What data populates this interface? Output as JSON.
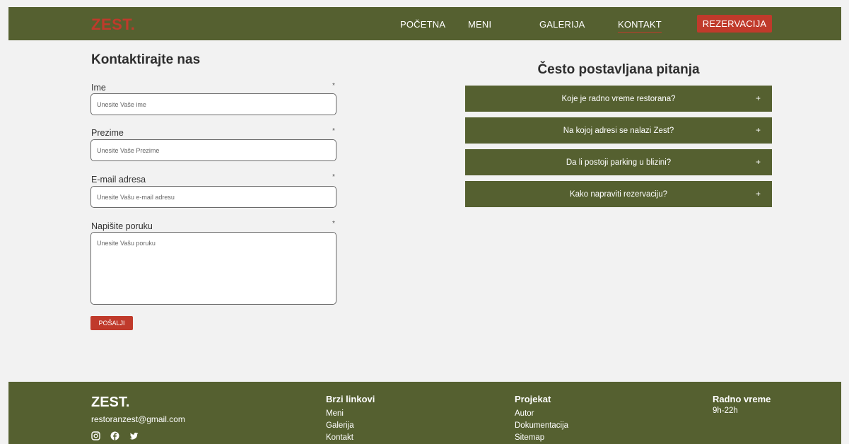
{
  "nav": {
    "logo": "ZEST.",
    "links": [
      "POČETNA",
      "MENI",
      "GALERIJA",
      "KONTAKT"
    ],
    "cta": "REZERVACIJA"
  },
  "form": {
    "title": "Kontaktirajte nas",
    "required_mark": "*",
    "fields": [
      {
        "label": "Ime",
        "placeholder": "Unesite Vaše ime"
      },
      {
        "label": "Prezime",
        "placeholder": "Unesite Vaše Prezime"
      },
      {
        "label": "E-mail adresa",
        "placeholder": "Unesite Vašu e-mail adresu"
      },
      {
        "label": "Napišite poruku",
        "placeholder": "Unesite Vašu poruku"
      }
    ],
    "submit": "POŠALJI"
  },
  "faq": {
    "title": "Često postavljana pitanja",
    "items": [
      "Koje je radno vreme restorana?",
      "Na kojoj adresi se nalazi Zest?",
      "Da li postoji parking u blizini?",
      "Kako napraviti rezervaciju?"
    ],
    "expand": "+"
  },
  "footer": {
    "logo": "ZEST.",
    "email": "restoranzest@gmail.com",
    "social_icons": [
      "instagram-icon",
      "facebook-icon",
      "twitter-icon"
    ],
    "quick_links": {
      "title": "Brzi linkovi",
      "items": [
        "Meni",
        "Galerija",
        "Kontakt"
      ]
    },
    "project": {
      "title": "Projekat",
      "items": [
        "Autor",
        "Dokumentacija",
        "Sitemap"
      ]
    },
    "hours": {
      "title": "Radno vreme",
      "value": "9h-22h"
    }
  },
  "colors": {
    "olive": "#556030",
    "accent": "#c03a2b",
    "background": "#f2f2f2"
  }
}
